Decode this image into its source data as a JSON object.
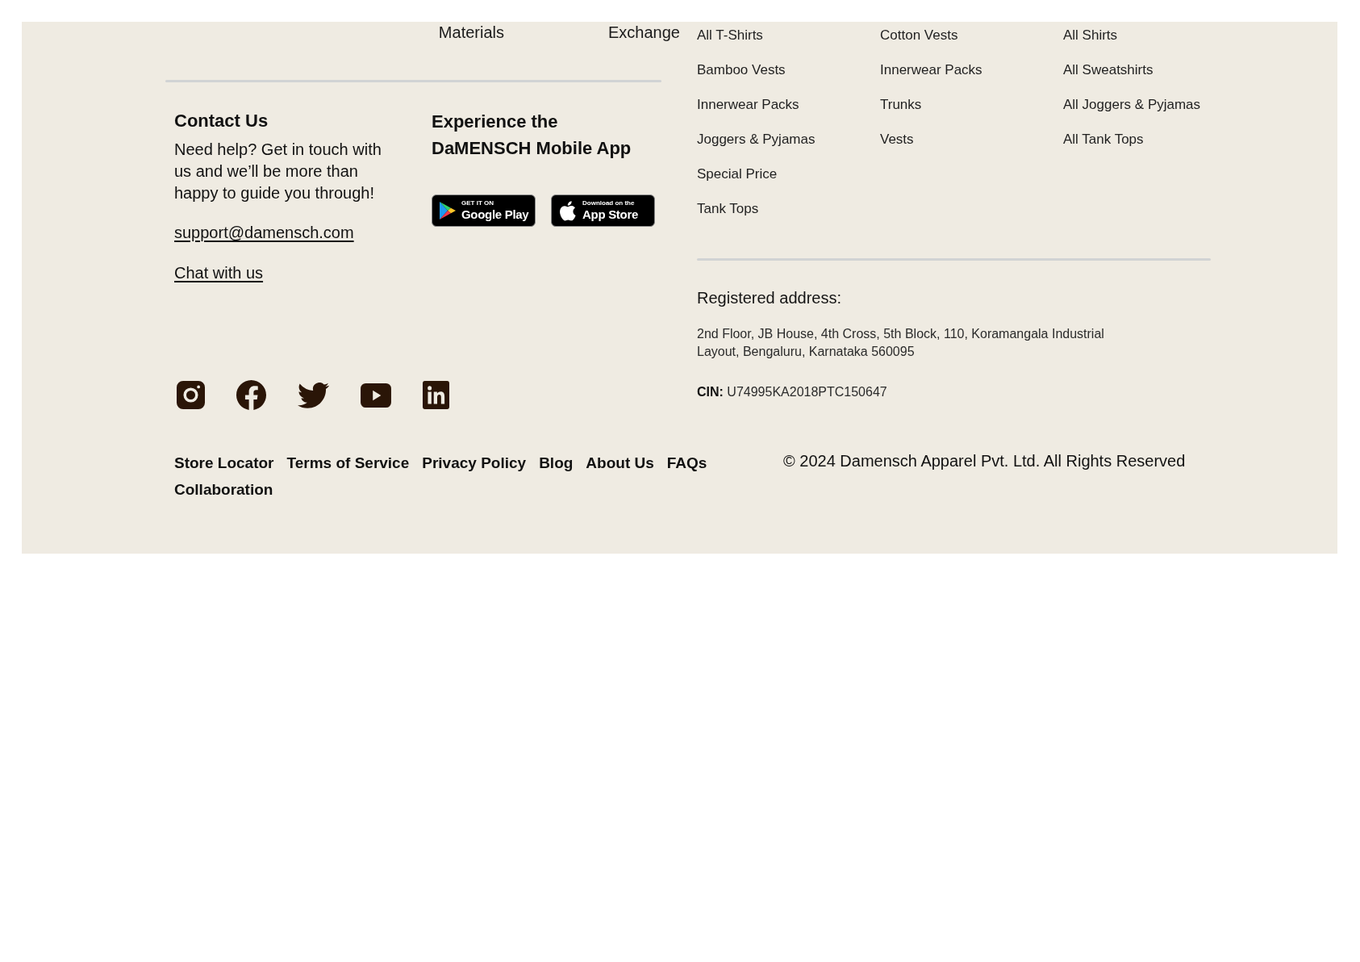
{
  "top_links": [
    "Materials",
    "Exchange"
  ],
  "category_columns": [
    {
      "links": [
        "All T-Shirts",
        "Bamboo Vests",
        "Innerwear Packs",
        "Joggers & Pyjamas",
        "Special Price",
        "Tank Tops"
      ]
    },
    {
      "links": [
        "Cotton Vests",
        "Innerwear Packs",
        "Trunks",
        "Vests"
      ]
    },
    {
      "links": [
        "All Shirts",
        "All Sweatshirts",
        "All Joggers & Pyjamas",
        "All Tank Tops"
      ]
    }
  ],
  "contact": {
    "title": "Contact Us",
    "text": "Need help? Get in touch with us and we’ll be more than happy to guide you through!",
    "email": "support@damensch.com",
    "chat": "Chat with us"
  },
  "app": {
    "title": "Experience the DaMENSCH Mobile App",
    "badges": [
      {
        "kind": "google_play",
        "small": "GET IT ON",
        "large": "Google Play"
      },
      {
        "kind": "app_store",
        "small": "Download on the",
        "large": "App Store"
      }
    ]
  },
  "registered": {
    "title": "Registered address:",
    "address": "2nd Floor, JB House, 4th Cross, 5th Block, 110, Koramangala Industrial Layout, Bengaluru, Karnataka 560095",
    "cin": "**CIN:** U74995KA2018PTC150647"
  },
  "bottom_links": [
    "Store Locator",
    "Terms of Service",
    "Privacy Policy",
    "Blog",
    "About Us",
    "FAQs",
    "Collaboration"
  ],
  "copyright": "© 2024 Damensch Apparel Pvt. Ltd. All Rights Reserved"
}
